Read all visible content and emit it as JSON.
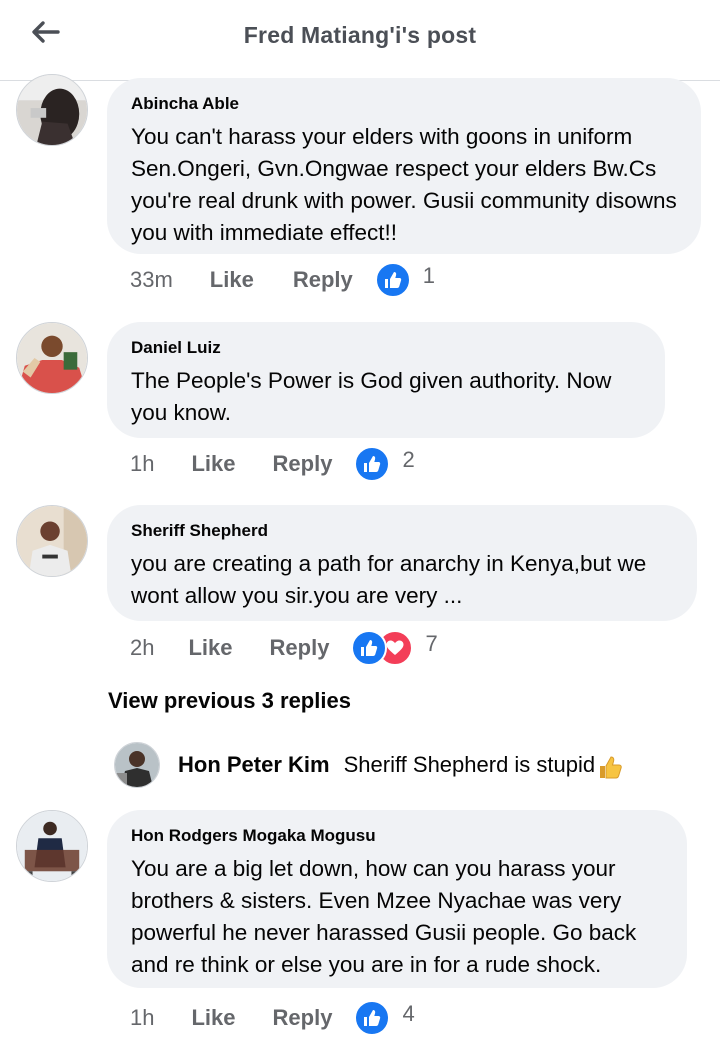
{
  "header": {
    "title": "Fred Matiang'i's post"
  },
  "actions": {
    "like": "Like",
    "reply": "Reply"
  },
  "comments": [
    {
      "author": "Abincha Able",
      "text": "You can't harass your elders with goons in uniform Sen.Ongeri, Gvn.Ongwae respect your elders Bw.Cs you're real drunk with power. Gusii community disowns you with immediate effect!!",
      "time": "33m",
      "reactions": [
        "like"
      ],
      "reaction_count": "1"
    },
    {
      "author": "Daniel Luiz",
      "text": "The People's Power is God given authority. Now you know.",
      "time": "1h",
      "reactions": [
        "like"
      ],
      "reaction_count": "2"
    },
    {
      "author": "Sheriff Shepherd",
      "text": "you are creating a path for anarchy in Kenya,but we wont allow you sir.you are very ...",
      "time": "2h",
      "reactions": [
        "like",
        "love"
      ],
      "reaction_count": "7"
    },
    {
      "author": "Hon Rodgers Mogaka Mogusu",
      "text": "You are a big let down, how can you harass your brothers & sisters. Even Mzee Nyachae was very powerful he never harassed Gusii people. Go back and re think or else you are in for a rude shock.",
      "time": "1h",
      "reactions": [
        "like"
      ],
      "reaction_count": "4"
    }
  ],
  "view_previous": "View previous 3 replies",
  "reply_preview": {
    "author": "Hon Peter Kim",
    "text": "Sheriff Shepherd is stupid",
    "emoji": "thumbs-up-emoji"
  },
  "colors": {
    "like_blue": "#1877f2",
    "love_red": "#f33e58",
    "bubble_bg": "#f0f2f5",
    "meta_gray": "#65676b"
  }
}
